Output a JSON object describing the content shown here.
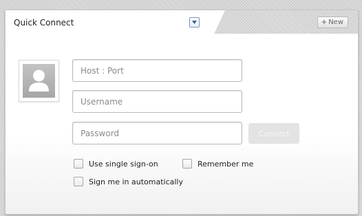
{
  "tab": {
    "title": "Quick Connect",
    "dropdown_icon": "chevron-down-icon",
    "new_label": "New",
    "new_icon": "plus-icon"
  },
  "avatar": {
    "icon": "user-silhouette-icon"
  },
  "form": {
    "host_placeholder": "Host : Port",
    "host_value": "",
    "username_placeholder": "Username",
    "username_value": "",
    "password_placeholder": "Password",
    "password_value": "",
    "connect_label": "Connect"
  },
  "options": {
    "single_sign_on": {
      "label": "Use single sign-on",
      "checked": false
    },
    "remember_me": {
      "label": "Remember me",
      "checked": false
    },
    "auto_sign_in": {
      "label": "Sign me in automatically",
      "checked": false
    }
  },
  "colors": {
    "dropdown_border": "#7d94b7",
    "connect_disabled_bg": "#e3e3e3",
    "field_border": "#b9b9b9"
  }
}
